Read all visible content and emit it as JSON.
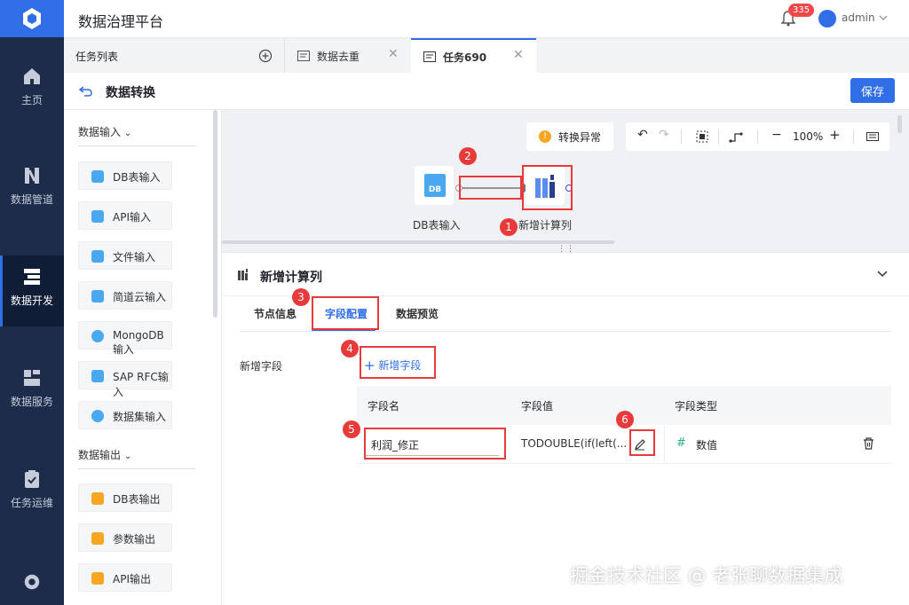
{
  "app": {
    "title": "数据治理平台",
    "notification_count": "335",
    "user": "admin"
  },
  "nav": {
    "items": [
      {
        "label": "主页",
        "icon": "home-icon"
      },
      {
        "label": "数据管道",
        "icon": "pipeline-icon"
      },
      {
        "label": "数据开发",
        "icon": "dev-icon",
        "active": true
      },
      {
        "label": "数据服务",
        "icon": "service-icon"
      },
      {
        "label": "任务运维",
        "icon": "clipboard-icon"
      }
    ],
    "settings_icon": "gear-icon"
  },
  "tabs": {
    "list_label": "任务列表",
    "items": [
      {
        "label": "数据去重"
      },
      {
        "label": "任务690",
        "active": true
      }
    ]
  },
  "header": {
    "title": "数据转换",
    "save_label": "保存"
  },
  "palette": {
    "input_group": "数据输入",
    "inputs": [
      "DB表输入",
      "API输入",
      "文件输入",
      "简道云输入",
      "MongoDB输入",
      "SAP RFC输入",
      "数据集输入"
    ],
    "output_group": "数据输出",
    "outputs": [
      "DB表输出",
      "参数输出",
      "API输出"
    ]
  },
  "canvas": {
    "exception_label": "转换异常",
    "zoom": "100%",
    "source_node": {
      "label": "DB表输入",
      "icon_text": "DB"
    },
    "target_node": {
      "label": "新增计算列"
    }
  },
  "config": {
    "title": "新增计算列",
    "tabs": [
      "节点信息",
      "字段配置",
      "数据预览"
    ],
    "active_tab": "字段配置",
    "add_field_section": "新增字段",
    "add_field_button": "新增字段",
    "table": {
      "headers": [
        "字段名",
        "字段值",
        "字段类型"
      ],
      "rows": [
        {
          "name": "利润_修正",
          "value": "TODOUBLE(if(left(...",
          "type": "数值"
        }
      ]
    }
  },
  "annotations": [
    "1",
    "2",
    "3",
    "4",
    "5",
    "6"
  ],
  "watermark": "掘金技术社区 @ 老张聊数据集成",
  "colors": {
    "primary": "#2f6ee6",
    "nav_bg": "#1c2c4a",
    "annotation": "#e83a3a",
    "badge": "#f0474a"
  }
}
